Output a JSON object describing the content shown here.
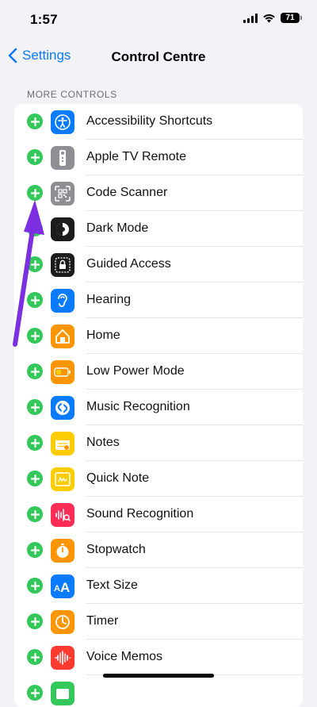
{
  "status_bar": {
    "time": "1:57",
    "battery": "71"
  },
  "nav": {
    "back_label": "Settings",
    "title": "Control Centre"
  },
  "section": {
    "header": "MORE CONTROLS"
  },
  "items": [
    {
      "label": "Accessibility Shortcuts",
      "icon": "accessibility-icon",
      "color": "#0a7aff"
    },
    {
      "label": "Apple TV Remote",
      "icon": "tv-remote-icon",
      "color": "#8e8e93"
    },
    {
      "label": "Code Scanner",
      "icon": "qr-code-icon",
      "color": "#8e8e93"
    },
    {
      "label": "Dark Mode",
      "icon": "dark-mode-icon",
      "color": "#1c1c1e"
    },
    {
      "label": "Guided Access",
      "icon": "lock-icon",
      "color": "#1c1c1e"
    },
    {
      "label": "Hearing",
      "icon": "ear-icon",
      "color": "#0a7aff"
    },
    {
      "label": "Home",
      "icon": "home-icon",
      "color": "#ff9500"
    },
    {
      "label": "Low Power Mode",
      "icon": "battery-icon",
      "color": "#ff9500"
    },
    {
      "label": "Music Recognition",
      "icon": "shazam-icon",
      "color": "#0a7aff"
    },
    {
      "label": "Notes",
      "icon": "notes-icon",
      "color": "#ffcc00"
    },
    {
      "label": "Quick Note",
      "icon": "quick-note-icon",
      "color": "#ffcc00"
    },
    {
      "label": "Sound Recognition",
      "icon": "waveform-icon",
      "color": "#ff2d55"
    },
    {
      "label": "Stopwatch",
      "icon": "stopwatch-icon",
      "color": "#ff9500"
    },
    {
      "label": "Text Size",
      "icon": "text-size-icon",
      "color": "#0a7aff"
    },
    {
      "label": "Timer",
      "icon": "timer-icon",
      "color": "#ff9500"
    },
    {
      "label": "Voice Memos",
      "icon": "voice-memo-icon",
      "color": "#ff3b30"
    },
    {
      "label": "",
      "icon": "wallet-icon",
      "color": "#34c759"
    }
  ],
  "colors": {
    "accent": "#0a7aff",
    "add": "#34c759",
    "annotation": "#7b2fe0"
  }
}
